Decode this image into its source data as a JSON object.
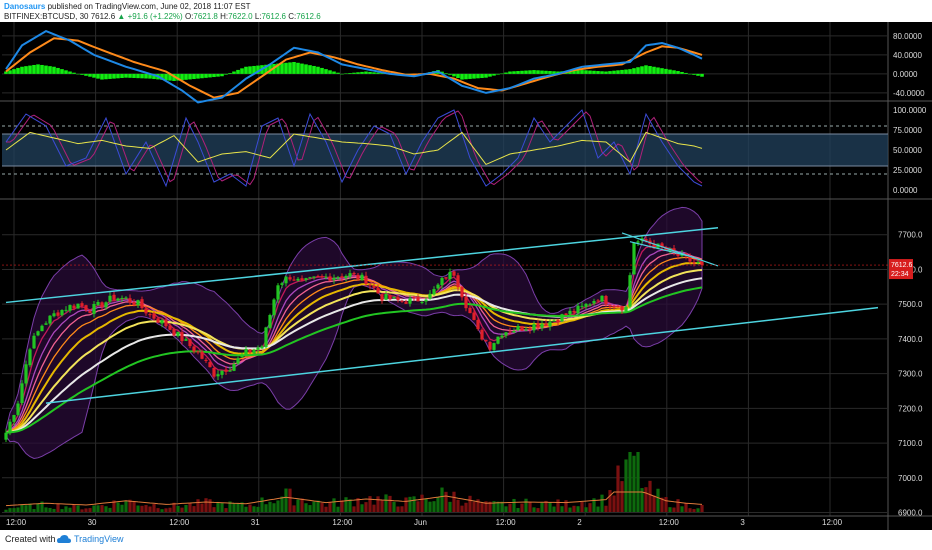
{
  "header": {
    "author": "Danosaurs",
    "published_text": "published on TradingView.com, June 02, 2018 11:07 EST",
    "symbol": "BITFINEX:BTCUSD, 30",
    "last": "7612.6",
    "change": "+91.6 (+1.22%)",
    "o_label": "O:",
    "o_value": "7621.8",
    "h_label": "H:",
    "h_value": "7622.0",
    "l_label": "L:",
    "l_value": "7612.6",
    "c_label": "C:",
    "c_value": "7612.6"
  },
  "footer": {
    "created_with": "Created with",
    "brand": "TradingView"
  },
  "colors": {
    "background": "#000000",
    "grid": "#2a2a2a",
    "candle_up": "#22c522",
    "candle_down": "#e0202a",
    "channel": "#4dd4e0",
    "macd_line": "#1e88e5",
    "signal_line": "#ff8a1a",
    "histogram": "#11ee11",
    "stoch_k": "#3b4bd6",
    "stoch_d": "#b0207a",
    "rsi_line": "#e8e44a",
    "band_fill": "#22415e",
    "price_badge": "#d81e1e"
  },
  "chart_data": {
    "type": "candlestick",
    "interval": "30",
    "price_axis": {
      "ticks": [
        "7700.0",
        "7600.0",
        "7500.0",
        "7400.0",
        "7300.0",
        "7200.0",
        "7100.0",
        "7000.0",
        "6900.0"
      ],
      "range": [
        6890,
        7800
      ]
    },
    "time_axis": {
      "ticks": [
        "12:00",
        "30",
        "12:00",
        "31",
        "12:00",
        "Jun",
        "12:00",
        "2",
        "12:00",
        "3",
        "12:00"
      ]
    },
    "last_price_label": "7612.6",
    "countdown_label": "22:34",
    "price_path": [
      [
        0,
        7130
      ],
      [
        3,
        7220
      ],
      [
        6,
        7380
      ],
      [
        9,
        7440
      ],
      [
        12,
        7470
      ],
      [
        15,
        7490
      ],
      [
        18,
        7500
      ],
      [
        21,
        7485
      ],
      [
        24,
        7500
      ],
      [
        27,
        7520
      ],
      [
        30,
        7515
      ],
      [
        33,
        7500
      ],
      [
        36,
        7470
      ],
      [
        40,
        7440
      ],
      [
        44,
        7400
      ],
      [
        48,
        7360
      ],
      [
        52,
        7300
      ],
      [
        56,
        7320
      ],
      [
        60,
        7360
      ],
      [
        64,
        7380
      ],
      [
        68,
        7560
      ],
      [
        71,
        7580
      ],
      [
        74,
        7560
      ],
      [
        78,
        7575
      ],
      [
        82,
        7580
      ],
      [
        86,
        7585
      ],
      [
        90,
        7570
      ],
      [
        94,
        7520
      ],
      [
        98,
        7510
      ],
      [
        102,
        7510
      ],
      [
        106,
        7525
      ],
      [
        110,
        7580
      ],
      [
        112,
        7590
      ],
      [
        115,
        7500
      ],
      [
        118,
        7420
      ],
      [
        121,
        7380
      ],
      [
        124,
        7420
      ],
      [
        128,
        7430
      ],
      [
        132,
        7440
      ],
      [
        136,
        7450
      ],
      [
        140,
        7470
      ],
      [
        144,
        7490
      ],
      [
        148,
        7520
      ],
      [
        152,
        7500
      ],
      [
        155,
        7490
      ],
      [
        157,
        7680
      ],
      [
        160,
        7680
      ],
      [
        164,
        7660
      ],
      [
        168,
        7640
      ],
      [
        172,
        7620
      ],
      [
        174,
        7612.6
      ]
    ],
    "volume_path": [
      [
        0,
        4
      ],
      [
        10,
        8
      ],
      [
        20,
        5
      ],
      [
        30,
        12
      ],
      [
        40,
        6
      ],
      [
        50,
        10
      ],
      [
        60,
        7
      ],
      [
        70,
        18
      ],
      [
        80,
        9
      ],
      [
        90,
        15
      ],
      [
        100,
        11
      ],
      [
        110,
        20
      ],
      [
        120,
        8
      ],
      [
        130,
        10
      ],
      [
        140,
        9
      ],
      [
        150,
        14
      ],
      [
        157,
        60
      ],
      [
        160,
        25
      ],
      [
        165,
        12
      ],
      [
        170,
        8
      ],
      [
        174,
        6
      ]
    ],
    "channel_upper": [
      [
        0,
        7505
      ],
      [
        178,
        7720
      ]
    ],
    "channel_lower": [
      [
        10,
        7215
      ],
      [
        218,
        7490
      ]
    ],
    "flag_upper": [
      [
        154,
        7705
      ],
      [
        178,
        7610
      ]
    ],
    "flag_lower": [
      [
        156,
        7680
      ],
      [
        172,
        7635
      ]
    ],
    "macd": {
      "axis_ticks": [
        "80.0000",
        "40.0000",
        "0.0000",
        "-40.0000"
      ],
      "range": [
        -55,
        105
      ],
      "macd_path": [
        [
          0,
          10
        ],
        [
          4,
          60
        ],
        [
          10,
          90
        ],
        [
          16,
          70
        ],
        [
          22,
          40
        ],
        [
          30,
          15
        ],
        [
          38,
          -5
        ],
        [
          44,
          -35
        ],
        [
          48,
          -60
        ],
        [
          54,
          -50
        ],
        [
          60,
          -10
        ],
        [
          66,
          20
        ],
        [
          72,
          55
        ],
        [
          78,
          45
        ],
        [
          84,
          20
        ],
        [
          90,
          10
        ],
        [
          96,
          0
        ],
        [
          102,
          -5
        ],
        [
          108,
          5
        ],
        [
          114,
          -25
        ],
        [
          120,
          -40
        ],
        [
          126,
          -30
        ],
        [
          132,
          -10
        ],
        [
          138,
          0
        ],
        [
          144,
          15
        ],
        [
          150,
          20
        ],
        [
          156,
          25
        ],
        [
          160,
          60
        ],
        [
          164,
          65
        ],
        [
          168,
          55
        ],
        [
          172,
          40
        ],
        [
          174,
          32
        ]
      ],
      "signal_path": [
        [
          0,
          5
        ],
        [
          6,
          45
        ],
        [
          12,
          75
        ],
        [
          18,
          70
        ],
        [
          24,
          50
        ],
        [
          32,
          25
        ],
        [
          40,
          5
        ],
        [
          46,
          -25
        ],
        [
          52,
          -50
        ],
        [
          58,
          -40
        ],
        [
          64,
          -5
        ],
        [
          70,
          30
        ],
        [
          76,
          45
        ],
        [
          82,
          35
        ],
        [
          88,
          20
        ],
        [
          94,
          8
        ],
        [
          100,
          -2
        ],
        [
          106,
          0
        ],
        [
          112,
          -10
        ],
        [
          118,
          -30
        ],
        [
          124,
          -35
        ],
        [
          130,
          -20
        ],
        [
          136,
          -5
        ],
        [
          142,
          8
        ],
        [
          148,
          15
        ],
        [
          154,
          20
        ],
        [
          160,
          45
        ],
        [
          164,
          58
        ],
        [
          168,
          55
        ],
        [
          172,
          45
        ],
        [
          174,
          40
        ]
      ],
      "histogram_path": [
        [
          0,
          5
        ],
        [
          4,
          15
        ],
        [
          8,
          20
        ],
        [
          12,
          15
        ],
        [
          18,
          0
        ],
        [
          24,
          -12
        ],
        [
          30,
          -8
        ],
        [
          36,
          -10
        ],
        [
          42,
          -15
        ],
        [
          48,
          -10
        ],
        [
          54,
          -5
        ],
        [
          60,
          15
        ],
        [
          66,
          20
        ],
        [
          72,
          25
        ],
        [
          78,
          15
        ],
        [
          84,
          0
        ],
        [
          90,
          5
        ],
        [
          96,
          0
        ],
        [
          102,
          -5
        ],
        [
          108,
          8
        ],
        [
          114,
          -12
        ],
        [
          120,
          -8
        ],
        [
          126,
          5
        ],
        [
          132,
          8
        ],
        [
          138,
          5
        ],
        [
          144,
          8
        ],
        [
          150,
          5
        ],
        [
          156,
          10
        ],
        [
          160,
          18
        ],
        [
          164,
          12
        ],
        [
          168,
          6
        ],
        [
          172,
          -2
        ],
        [
          174,
          -6
        ]
      ]
    },
    "stoch_rsi": {
      "axis_ticks": [
        "100.0000",
        "75.0000",
        "50.0000",
        "25.0000",
        "0.0000"
      ],
      "range": [
        0,
        100
      ],
      "upper_band": 70,
      "lower_band": 30,
      "upper_dash": 80,
      "lower_dash": 20,
      "rsi_path": [
        [
          0,
          50
        ],
        [
          6,
          72
        ],
        [
          12,
          65
        ],
        [
          18,
          58
        ],
        [
          24,
          62
        ],
        [
          30,
          55
        ],
        [
          36,
          52
        ],
        [
          42,
          68
        ],
        [
          48,
          35
        ],
        [
          54,
          45
        ],
        [
          60,
          48
        ],
        [
          66,
          40
        ],
        [
          72,
          70
        ],
        [
          78,
          65
        ],
        [
          84,
          60
        ],
        [
          90,
          58
        ],
        [
          96,
          55
        ],
        [
          102,
          45
        ],
        [
          108,
          50
        ],
        [
          114,
          72
        ],
        [
          120,
          32
        ],
        [
          126,
          45
        ],
        [
          132,
          50
        ],
        [
          138,
          55
        ],
        [
          144,
          62
        ],
        [
          150,
          60
        ],
        [
          156,
          35
        ],
        [
          160,
          72
        ],
        [
          164,
          65
        ],
        [
          168,
          58
        ],
        [
          172,
          55
        ],
        [
          174,
          52
        ]
      ],
      "stoch_path": [
        [
          0,
          60
        ],
        [
          5,
          95
        ],
        [
          10,
          80
        ],
        [
          15,
          30
        ],
        [
          20,
          40
        ],
        [
          25,
          90
        ],
        [
          30,
          20
        ],
        [
          35,
          60
        ],
        [
          40,
          5
        ],
        [
          45,
          90
        ],
        [
          48,
          60
        ],
        [
          52,
          10
        ],
        [
          56,
          20
        ],
        [
          60,
          5
        ],
        [
          64,
          80
        ],
        [
          68,
          90
        ],
        [
          72,
          30
        ],
        [
          76,
          95
        ],
        [
          80,
          60
        ],
        [
          84,
          10
        ],
        [
          88,
          50
        ],
        [
          92,
          80
        ],
        [
          96,
          70
        ],
        [
          100,
          20
        ],
        [
          104,
          60
        ],
        [
          108,
          90
        ],
        [
          112,
          100
        ],
        [
          116,
          40
        ],
        [
          120,
          5
        ],
        [
          124,
          20
        ],
        [
          128,
          40
        ],
        [
          132,
          90
        ],
        [
          136,
          60
        ],
        [
          140,
          80
        ],
        [
          144,
          100
        ],
        [
          148,
          40
        ],
        [
          152,
          60
        ],
        [
          156,
          20
        ],
        [
          160,
          95
        ],
        [
          164,
          60
        ],
        [
          168,
          30
        ],
        [
          172,
          10
        ],
        [
          174,
          5
        ]
      ]
    }
  }
}
